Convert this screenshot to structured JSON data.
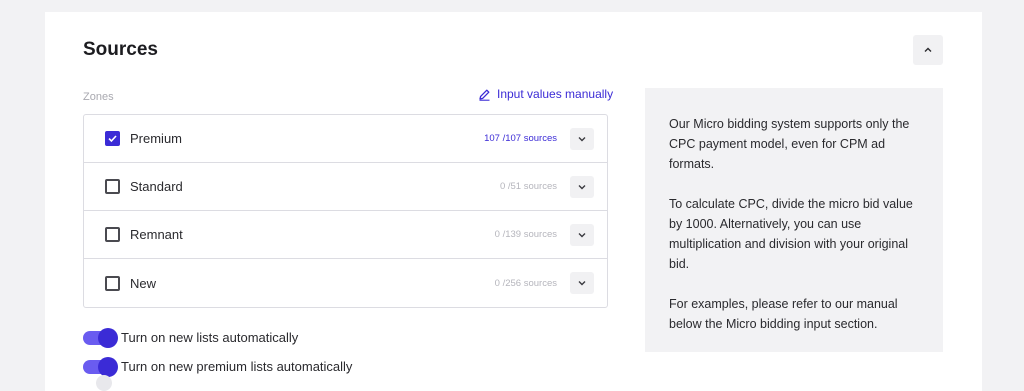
{
  "section": {
    "title": "Sources"
  },
  "zones": {
    "label": "Zones",
    "manual_link": "Input values manually",
    "items": [
      {
        "name": "Premium",
        "count": "107 /107  sources",
        "checked": true
      },
      {
        "name": "Standard",
        "count": "0 /51 sources",
        "checked": false
      },
      {
        "name": "Remnant",
        "count": "0 /139 sources",
        "checked": false
      },
      {
        "name": "New",
        "count": "0 /256 sources",
        "checked": false
      }
    ]
  },
  "toggles": [
    {
      "label": "Turn on new lists automatically",
      "on": true
    },
    {
      "label": "Turn on new premium lists automatically",
      "on": true
    }
  ],
  "info": {
    "paragraph1": "Our Micro bidding system supports only the CPC payment model, even for CPM ad formats.",
    "paragraph2": "To calculate CPC, divide the micro bid value by 1000. Alternatively, you can use multiplication and division with your original bid.",
    "paragraph3": "For examples, please refer to our manual below the Micro bidding input section."
  },
  "colors": {
    "accent": "#3b2bd6",
    "toggle_track": "#6a5cf0",
    "muted": "#b5b5bc",
    "panel_bg": "#f2f2f4"
  },
  "icons": {
    "collapse": "chevron-up-icon",
    "expand": "chevron-down-icon",
    "manual": "pencil-icon",
    "check": "check-icon"
  }
}
